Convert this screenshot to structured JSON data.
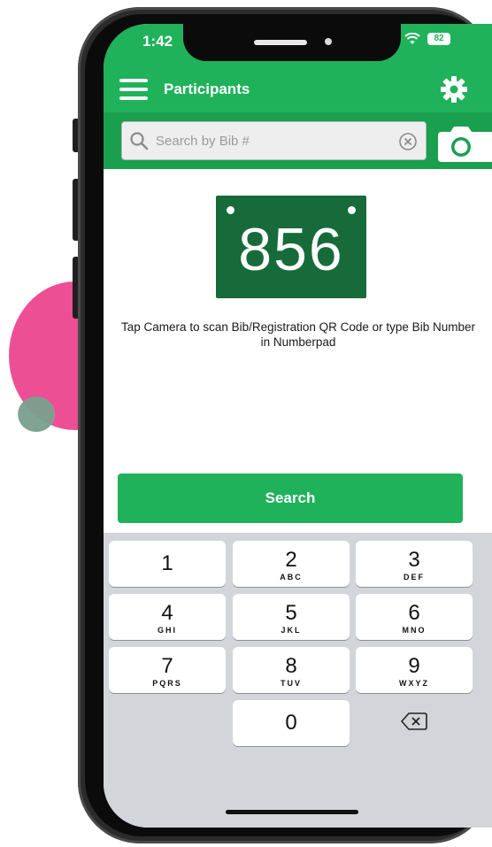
{
  "status_bar": {
    "time": "1:42",
    "battery": "82"
  },
  "header": {
    "title": "Participants",
    "menu_icon": "hamburger-menu-icon",
    "settings_icon": "gear-icon"
  },
  "search": {
    "placeholder": "Search by Bib #",
    "value": "",
    "search_icon": "magnifier-icon",
    "clear_icon": "clear-circle-icon",
    "camera_icon": "camera-icon"
  },
  "bib": {
    "number": "856"
  },
  "instruction": "Tap Camera to scan Bib/Registration QR Code or type Bib Number in Numberpad",
  "search_button_label": "Search",
  "keypad": {
    "keys": [
      {
        "digit": "1",
        "letters": ""
      },
      {
        "digit": "2",
        "letters": "ABC"
      },
      {
        "digit": "3",
        "letters": "DEF"
      },
      {
        "digit": "4",
        "letters": "GHI"
      },
      {
        "digit": "5",
        "letters": "JKL"
      },
      {
        "digit": "6",
        "letters": "MNO"
      },
      {
        "digit": "7",
        "letters": "PQRS"
      },
      {
        "digit": "8",
        "letters": "TUV"
      },
      {
        "digit": "9",
        "letters": "WXYZ"
      },
      {
        "digit": "0",
        "letters": ""
      }
    ],
    "backspace_icon": "backspace-icon"
  },
  "colors": {
    "brand_green": "#1fb25a",
    "bib_green": "#176b3a",
    "decor_pink": "#ec4f93",
    "decor_mint": "#7fcba6"
  }
}
